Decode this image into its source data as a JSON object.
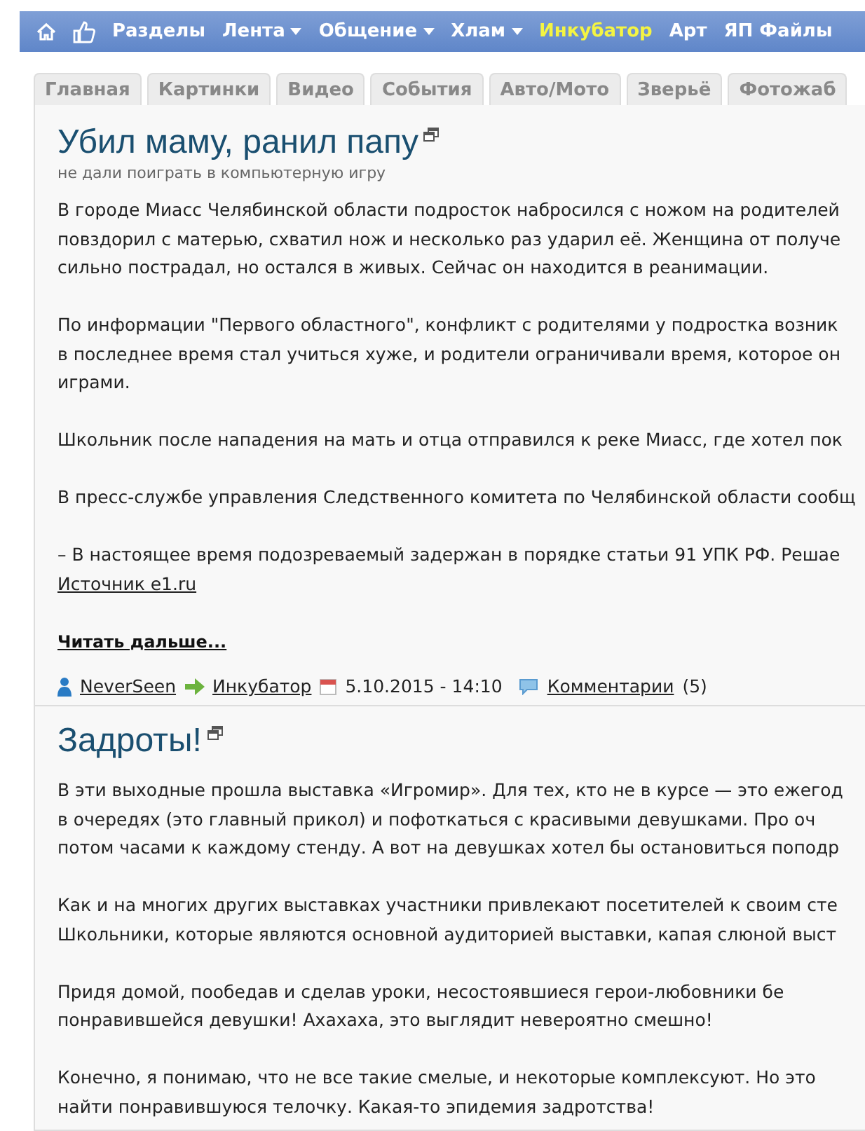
{
  "nav": {
    "items": [
      {
        "label": "Разделы",
        "kind": "link",
        "selected": false
      },
      {
        "label": "Лента",
        "kind": "dropdown",
        "selected": false
      },
      {
        "label": "Общение",
        "kind": "dropdown",
        "selected": false
      },
      {
        "label": "Хлам",
        "kind": "dropdown",
        "selected": false
      },
      {
        "label": "Инкубатор",
        "kind": "link",
        "selected": true
      },
      {
        "label": "Арт",
        "kind": "link",
        "selected": false
      },
      {
        "label": "ЯП Файлы",
        "kind": "link",
        "selected": false
      }
    ]
  },
  "tabs": [
    {
      "label": "Главная"
    },
    {
      "label": "Картинки"
    },
    {
      "label": "Видео"
    },
    {
      "label": "События"
    },
    {
      "label": "Авто/Мото"
    },
    {
      "label": "Зверьё"
    },
    {
      "label": "Фотожаб"
    }
  ],
  "articles": [
    {
      "title": "Убил маму, ранил папу",
      "subtitle": "не дали поиграть в компьютерную игру",
      "paragraphs": [
        [
          "В городе Миасс Челябинской области подросток набросился с ножом на родителей",
          "повздорил с матерью, схватил нож и несколько раз ударил её. Женщина от получе",
          "сильно пострадал, но остался в живых. Сейчас он находится в реанимации."
        ],
        [
          "По информации \"Первого областного\", конфликт с родителями у подростка возник",
          "в последнее время стал учиться хуже, и родители ограничивали время, которое он",
          "играми."
        ],
        [
          "Школьник после нападения на мать и отца отправился к реке Миасс, где хотел пок"
        ],
        [
          "В пресс-службе управления Следственного комитета по Челябинской области сообщ"
        ],
        [
          "– В настоящее время подозреваемый задержан в порядке статьи 91 УПК РФ. Решае"
        ]
      ],
      "source": "Источник e1.ru",
      "read_more": "Читать дальше...",
      "meta": {
        "author": "NeverSeen",
        "section": "Инкубатор",
        "date": "5.10.2015 - 14:10",
        "comments_link": "Комментарии",
        "comments_count": "(5)"
      }
    },
    {
      "title": "Задроты!",
      "paragraphs": [
        [
          "В эти выходные прошла выставка «Игромир». Для тех, кто не в курсе — это ежегод",
          "в очередях (это главный прикол) и пофоткаться с красивыми девушками. Про оч",
          "потом часами к каждому стенду. А вот на девушках хотел бы остановиться поподр"
        ],
        [
          "Как и на многих других выставках участники привлекают посетителей к своим сте",
          "Школьники, которые являются основной аудиторией выставки, капая слюной выст"
        ],
        [
          "Придя домой, пообедав и сделав уроки, несостоявшиеся герои-любовники бе",
          "понравившейся девушки! Ахахаха, это выглядит невероятно смешно!"
        ],
        [
          "Конечно, я понимаю, что не все такие смелые, и некоторые комплексуют. Но это",
          "найти понравившуюся телочку. Какая-то эпидемия задротства!"
        ]
      ]
    }
  ]
}
